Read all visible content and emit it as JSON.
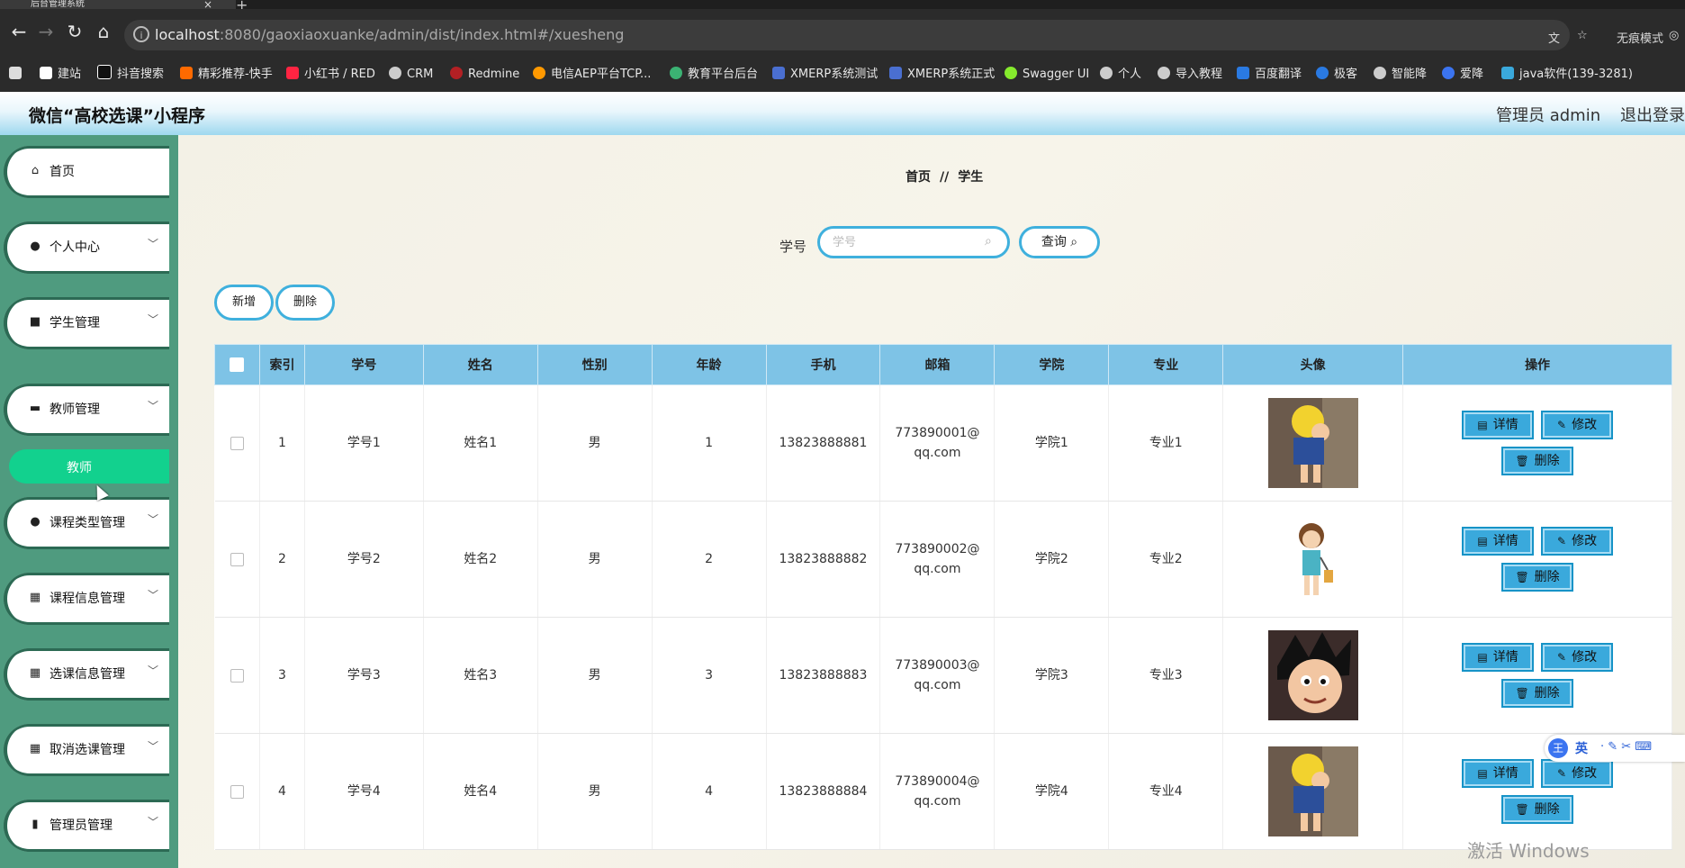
{
  "browser": {
    "tab_title": "后台管理系统",
    "url_host": "localhost",
    "url_rest": ":8080/gaoxiaoxuanke/admin/dist/index.html#/xuesheng",
    "incognito_label": "无痕模式",
    "bookmarks": [
      {
        "label": "建站",
        "color": "#ffffff"
      },
      {
        "label": "抖音搜索",
        "color": "#111111"
      },
      {
        "label": "精彩推荐-快手",
        "color": "#ff6a00"
      },
      {
        "label": "小红书 / RED",
        "color": "#ff2442"
      },
      {
        "label": "CRM",
        "color": "#cccccc"
      },
      {
        "label": "Redmine",
        "color": "#b32024"
      },
      {
        "label": "电信AEP平台TCP...",
        "color": "#ff9900"
      },
      {
        "label": "教育平台后台",
        "color": "#3bb273"
      },
      {
        "label": "XMERP系统测试",
        "color": "#4a6fd1"
      },
      {
        "label": "XMERP系统正式",
        "color": "#4a6fd1"
      },
      {
        "label": "Swagger UI",
        "color": "#85ea2d"
      },
      {
        "label": "个人",
        "color": "#cccccc"
      },
      {
        "label": "导入教程",
        "color": "#cccccc"
      },
      {
        "label": "百度翻译",
        "color": "#2a7ae2"
      },
      {
        "label": "极客",
        "color": "#2a7ae2"
      },
      {
        "label": "智能降",
        "color": "#cccccc"
      },
      {
        "label": "爱降",
        "color": "#3b74f0"
      },
      {
        "label": "java软件(139-3281)",
        "color": "#3aa9dc"
      }
    ]
  },
  "header": {
    "title": "微信“高校选课”小程序",
    "user": "管理员 admin",
    "logout": "退出登录"
  },
  "sidebar": {
    "items": [
      {
        "label": "首页",
        "icon": "home-icon",
        "glyph": "⌂"
      },
      {
        "label": "个人中心",
        "icon": "user-icon",
        "glyph": "●"
      },
      {
        "label": "学生管理",
        "icon": "briefcase-icon",
        "glyph": "■"
      },
      {
        "label": "教师管理",
        "icon": "ticket-icon",
        "glyph": "▬"
      },
      {
        "label": "课程类型管理",
        "icon": "bulb-icon",
        "glyph": "●"
      },
      {
        "label": "课程信息管理",
        "icon": "grid-icon",
        "glyph": "▦"
      },
      {
        "label": "选课信息管理",
        "icon": "grid-icon",
        "glyph": "▦"
      },
      {
        "label": "取消选课管理",
        "icon": "grid-icon",
        "glyph": "▦"
      },
      {
        "label": "管理员管理",
        "icon": "ledger-icon",
        "glyph": "▮"
      }
    ],
    "active_subitem": "教师"
  },
  "breadcrumb": {
    "home": "首页",
    "sep": "//",
    "current": "学生"
  },
  "search": {
    "label": "学号",
    "placeholder": "学号",
    "button": "查询"
  },
  "toolbar": {
    "add": "新增",
    "delete": "删除"
  },
  "table": {
    "headers": [
      "索引",
      "学号",
      "姓名",
      "性别",
      "年龄",
      "手机",
      "邮箱",
      "学院",
      "专业",
      "头像",
      "操作"
    ],
    "rows": [
      {
        "index": "1",
        "xuehao": "学号1",
        "name": "姓名1",
        "gender": "男",
        "age": "1",
        "phone": "13823888881",
        "email": "773890001@qq.com",
        "college": "学院1",
        "major": "专业1",
        "avatar": "cartoon-kid-yellow-hat"
      },
      {
        "index": "2",
        "xuehao": "学号2",
        "name": "姓名2",
        "gender": "男",
        "age": "2",
        "phone": "13823888882",
        "email": "773890002@qq.com",
        "college": "学院2",
        "major": "专业2",
        "avatar": "cartoon-girl-lantern"
      },
      {
        "index": "3",
        "xuehao": "学号3",
        "name": "姓名3",
        "gender": "男",
        "age": "3",
        "phone": "13823888883",
        "email": "773890003@qq.com",
        "college": "学院3",
        "major": "专业3",
        "avatar": "cartoon-goku"
      },
      {
        "index": "4",
        "xuehao": "学号4",
        "name": "姓名4",
        "gender": "男",
        "age": "4",
        "phone": "13823888884",
        "email": "773890004@qq.com",
        "college": "学院4",
        "major": "专业4",
        "avatar": "cartoon-kid-yellow-hat"
      }
    ],
    "actions": {
      "detail": "详情",
      "edit": "修改",
      "delete": "删除"
    }
  },
  "ime": {
    "logo": "王",
    "lang": "英"
  },
  "watermark": "激活 Windows",
  "colors": {
    "accent": "#3fb0dd",
    "table_header": "#7ec3e6",
    "sidebar": "#4f9b7f",
    "active": "#12d18e",
    "action_button": "#3aa9dc"
  }
}
